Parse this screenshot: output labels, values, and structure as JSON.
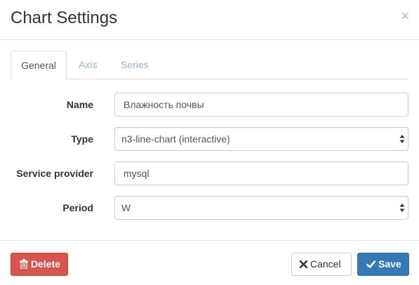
{
  "modal": {
    "title": "Chart Settings",
    "close_glyph": "×"
  },
  "tabs": [
    {
      "label": "General",
      "active": true
    },
    {
      "label": "Axis",
      "active": false
    },
    {
      "label": "Series",
      "active": false
    }
  ],
  "form": {
    "name": {
      "label": "Name",
      "value": "Влажность почвы"
    },
    "type": {
      "label": "Type",
      "value": "n3-line-chart (interactive)"
    },
    "service_provider": {
      "label": "Service provider",
      "value": "mysql"
    },
    "period": {
      "label": "Period",
      "value": "W"
    }
  },
  "footer": {
    "delete_label": "Delete",
    "cancel_label": "Cancel",
    "save_label": "Save"
  },
  "icons": {
    "delete": "trash-icon",
    "cancel": "x-mark-icon",
    "save": "checkmark-icon",
    "select": "chevron-up-down-icon"
  },
  "colors": {
    "danger": "#d9534f",
    "primary": "#337ab7",
    "muted_tab": "#9fb3c8",
    "border": "#cccccc"
  }
}
